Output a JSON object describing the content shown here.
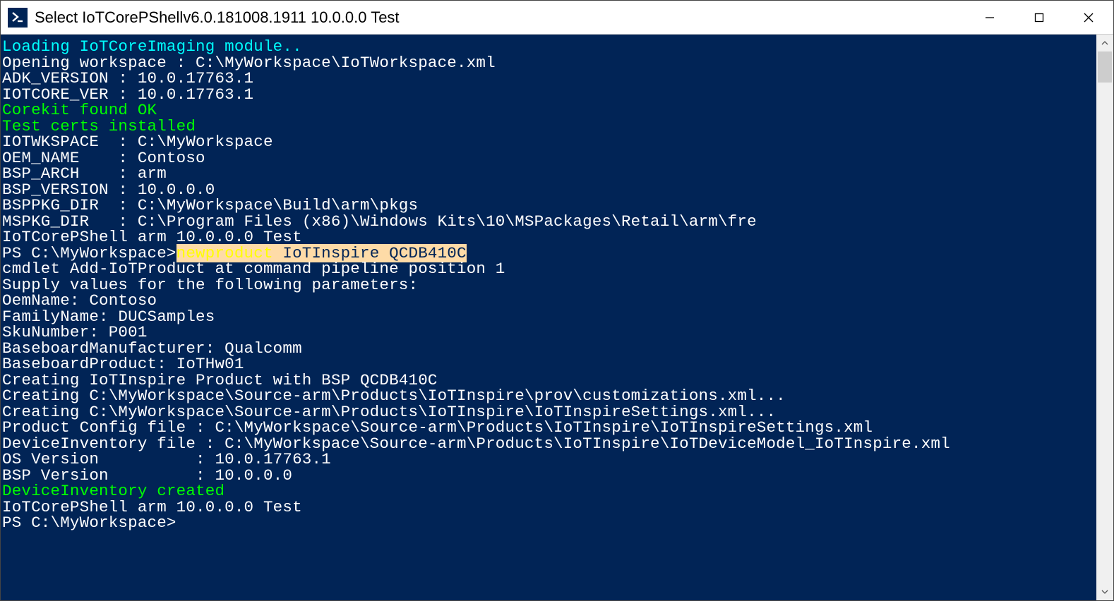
{
  "window": {
    "title": "Select IoTCorePShellv6.0.181008.1911 10.0.0.0 Test",
    "icon_glyph": ">_"
  },
  "terminal": {
    "lines": [
      {
        "cls": "cyan",
        "text": "Loading IoTCoreImaging module.."
      },
      {
        "cls": "",
        "text": "Opening workspace : C:\\MyWorkspace\\IoTWorkspace.xml"
      },
      {
        "cls": "",
        "text": "ADK_VERSION : 10.0.17763.1"
      },
      {
        "cls": "",
        "text": "IOTCORE_VER : 10.0.17763.1"
      },
      {
        "cls": "green",
        "text": "Corekit found OK"
      },
      {
        "cls": "green",
        "text": "Test certs installed"
      },
      {
        "cls": "",
        "text": "IOTWKSPACE  : C:\\MyWorkspace"
      },
      {
        "cls": "",
        "text": "OEM_NAME    : Contoso"
      },
      {
        "cls": "",
        "text": "BSP_ARCH    : arm"
      },
      {
        "cls": "",
        "text": "BSP_VERSION : 10.0.0.0"
      },
      {
        "cls": "",
        "text": "BSPPKG_DIR  : C:\\MyWorkspace\\Build\\arm\\pkgs"
      },
      {
        "cls": "",
        "text": "MSPKG_DIR   : C:\\Program Files (x86)\\Windows Kits\\10\\MSPackages\\Retail\\arm\\fre"
      },
      {
        "cls": "",
        "text": "IoTCorePShell arm 10.0.0.0 Test"
      }
    ],
    "prompt1_prefix": "PS C:\\MyWorkspace>",
    "prompt1_cmd_yellow": "newproduct",
    "prompt1_cmd_rest": " IoTInspire QCDB410C",
    "blank": "",
    "lines2": [
      {
        "cls": "",
        "text": "cmdlet Add-IoTProduct at command pipeline position 1"
      },
      {
        "cls": "",
        "text": "Supply values for the following parameters:"
      },
      {
        "cls": "",
        "text": "OemName: Contoso"
      },
      {
        "cls": "",
        "text": "FamilyName: DUCSamples"
      },
      {
        "cls": "",
        "text": "SkuNumber: P001"
      },
      {
        "cls": "",
        "text": "BaseboardManufacturer: Qualcomm"
      },
      {
        "cls": "",
        "text": "BaseboardProduct: IoTHw01"
      },
      {
        "cls": "",
        "text": "Creating IoTInspire Product with BSP QCDB410C"
      },
      {
        "cls": "",
        "text": "Creating C:\\MyWorkspace\\Source-arm\\Products\\IoTInspire\\prov\\customizations.xml..."
      },
      {
        "cls": "",
        "text": "Creating C:\\MyWorkspace\\Source-arm\\Products\\IoTInspire\\IoTInspireSettings.xml..."
      },
      {
        "cls": "",
        "text": "Product Config file : C:\\MyWorkspace\\Source-arm\\Products\\IoTInspire\\IoTInspireSettings.xml"
      },
      {
        "cls": "",
        "text": "DeviceInventory file : C:\\MyWorkspace\\Source-arm\\Products\\IoTInspire\\IoTDeviceModel_IoTInspire.xml"
      },
      {
        "cls": "",
        "text": "OS Version          : 10.0.17763.1"
      },
      {
        "cls": "",
        "text": "BSP Version         : 10.0.0.0"
      },
      {
        "cls": "green",
        "text": "DeviceInventory created"
      },
      {
        "cls": "",
        "text": "IoTCorePShell arm 10.0.0.0 Test"
      },
      {
        "cls": "",
        "text": "PS C:\\MyWorkspace>"
      }
    ]
  }
}
